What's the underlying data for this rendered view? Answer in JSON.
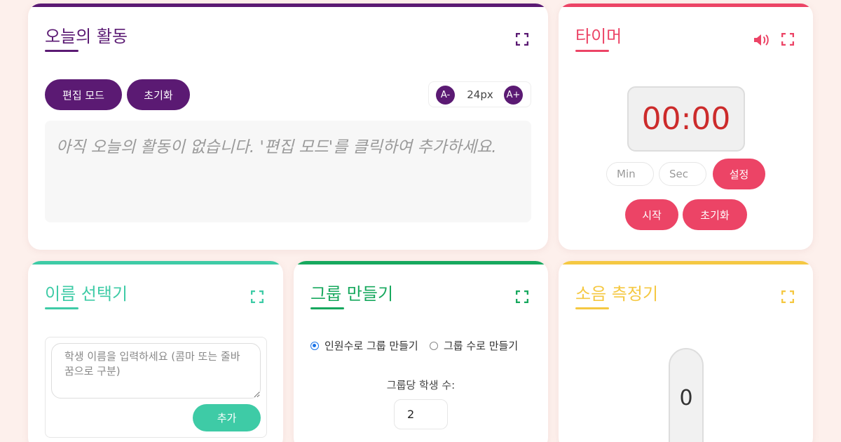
{
  "activity": {
    "title": "오늘의 활동",
    "edit_label": "편집 모드",
    "reset_label": "초기화",
    "font_decrease": "A-",
    "font_increase": "A+",
    "font_size": "24px",
    "placeholder": "아직 오늘의 활동이 없습니다. '편집 모드'를 클릭하여 추가하세요."
  },
  "timer": {
    "title": "타이머",
    "display": "00:00",
    "min_placeholder": "Min",
    "sec_placeholder": "Sec",
    "set_label": "설정",
    "start_label": "시작",
    "reset_label": "초기화"
  },
  "names": {
    "title": "이름 선택기",
    "placeholder": "학생 이름을 입력하세요 (콤마 또는 줄바꿈으로 구분)",
    "add_label": "추가"
  },
  "groups": {
    "title": "그룹 만들기",
    "option_by_size": "인원수로 그룹 만들기",
    "option_by_count": "그룹 수로 만들기",
    "per_group_label": "그룹당 학생 수:",
    "per_group_value": "2"
  },
  "noise": {
    "title": "소음 측정기",
    "level": "0"
  },
  "colors": {
    "activity": "#5b1a73",
    "timer": "#ec4466",
    "names": "#3ecba6",
    "groups": "#17a85e",
    "noise": "#f5c842",
    "background": "#fdf0ec"
  },
  "icons": {
    "fullscreen": "fullscreen-icon",
    "sound": "speaker-icon"
  }
}
